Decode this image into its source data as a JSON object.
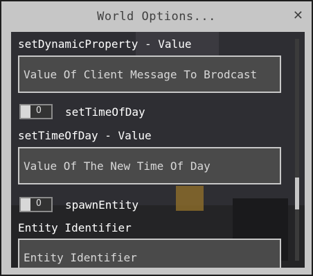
{
  "window": {
    "title": "World Options...",
    "close_symbol": "✕"
  },
  "fields": [
    {
      "label": "setDynamicProperty - Value",
      "value": "Value Of Client Message To Brodcast"
    },
    {
      "label": "setTimeOfDay - Value",
      "value": "Value Of The New Time Of Day"
    },
    {
      "label": "Entity Identifier",
      "value": "Entity Identifier"
    }
  ],
  "toggles": [
    {
      "label": "setTimeOfDay",
      "state_text": "O"
    },
    {
      "label": "spawnEntity",
      "state_text": "O"
    }
  ]
}
